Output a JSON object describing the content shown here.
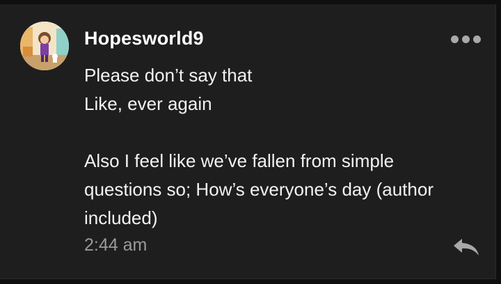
{
  "comment": {
    "author": "Hopesworld9",
    "lines": [
      "Please don’t say that",
      "Like, ever again",
      "",
      "Also I feel like we’ve fallen from simple",
      "questions so; How’s everyone’s day (author",
      "included)"
    ],
    "timestamp": "2:44 am",
    "avatar_icon": "avatar-cartoon-character",
    "more_icon": "more-options-icon",
    "reply_icon": "reply-arrow-icon"
  },
  "colors": {
    "background": "#1e1e1e",
    "text": "#f2f2f2",
    "timestamp": "#9a9a9a",
    "icon": "#a9a9a9"
  }
}
